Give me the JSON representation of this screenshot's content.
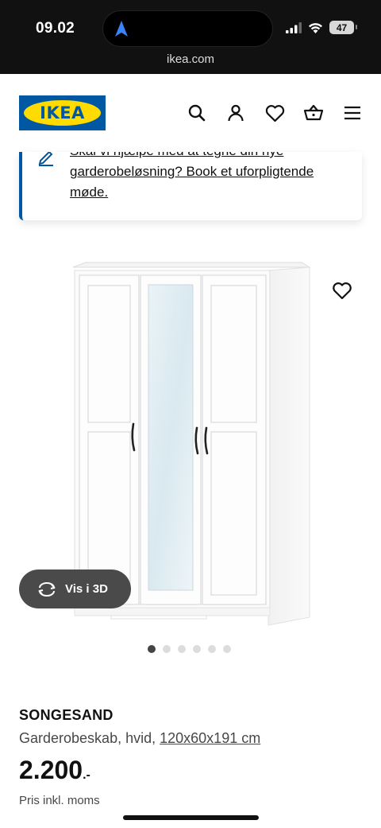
{
  "status_bar": {
    "time": "09.02",
    "battery": "47",
    "url": "ikea.com"
  },
  "header": {
    "logo_text": "IKEA",
    "icons": [
      "search-icon",
      "profile-icon",
      "heart-icon",
      "basket-icon",
      "menu-icon"
    ]
  },
  "banner": {
    "text": "Skal vi hjælpe med at tegne din nye garderobeløsning? Book et uforpligtende møde.",
    "icon": "pencil-icon"
  },
  "gallery": {
    "view_3d_label": "Vis i 3D",
    "image_count": 6,
    "active_index": 0
  },
  "product": {
    "name": "SONGESAND",
    "description": "Garderobeskab, hvid,",
    "dimensions": "120x60x191 cm",
    "price": "2.200",
    "price_suffix": ".-",
    "vat_note": "Pris inkl. moms"
  },
  "colors": {
    "ikea_blue": "#0058a3",
    "ikea_yellow": "#ffdb00"
  }
}
